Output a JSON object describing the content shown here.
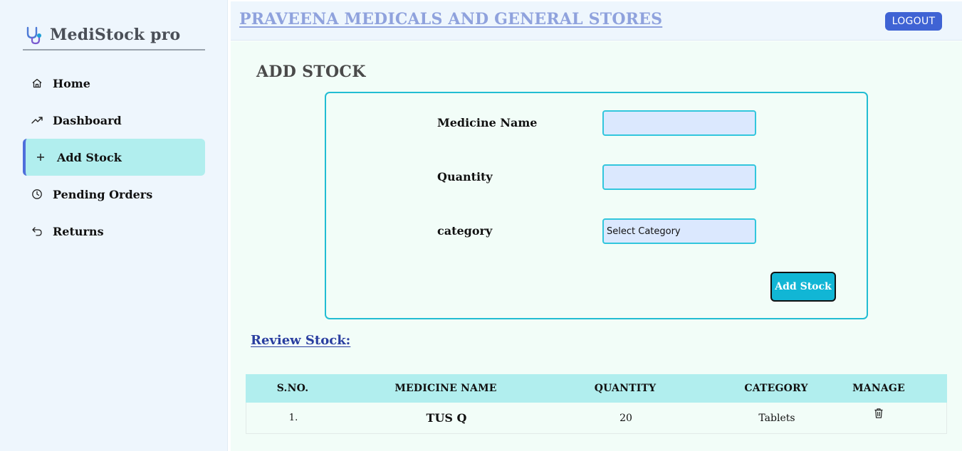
{
  "sidebar": {
    "brand": "MediStock pro",
    "items": [
      {
        "label": "Home",
        "icon": "home-icon"
      },
      {
        "label": "Dashboard",
        "icon": "trend-icon"
      },
      {
        "label": "Add Stock",
        "icon": "plus-icon",
        "active": true
      },
      {
        "label": "Pending Orders",
        "icon": "clock-icon"
      },
      {
        "label": "Returns",
        "icon": "return-icon"
      }
    ]
  },
  "header": {
    "store_name": "PRAVEENA MEDICALS AND GENERAL STORES",
    "logout_label": "LOGOUT"
  },
  "main": {
    "title": "ADD STOCK",
    "form": {
      "medicine_name_label": "Medicine Name",
      "medicine_name_value": "",
      "quantity_label": "Quantity",
      "quantity_value": "",
      "category_label": "category",
      "category_selected": "Select Category",
      "submit_label": "Add Stock"
    },
    "review_title": "Review Stock:",
    "table": {
      "headers": [
        "S.NO.",
        "MEDICINE NAME",
        "QUANTITY",
        "CATEGORY",
        "MANAGE"
      ],
      "rows": [
        {
          "sno": "1.",
          "name": "TUS Q",
          "quantity": "20",
          "category": "Tablets",
          "manage_icon": "trash-icon"
        }
      ]
    }
  },
  "colors": {
    "accent_teal": "#b1eeee",
    "button_teal": "#11b6d5",
    "logout_blue": "#3f63d4",
    "store_name": "#8fa2dd",
    "review_title": "#2a3ea0"
  }
}
